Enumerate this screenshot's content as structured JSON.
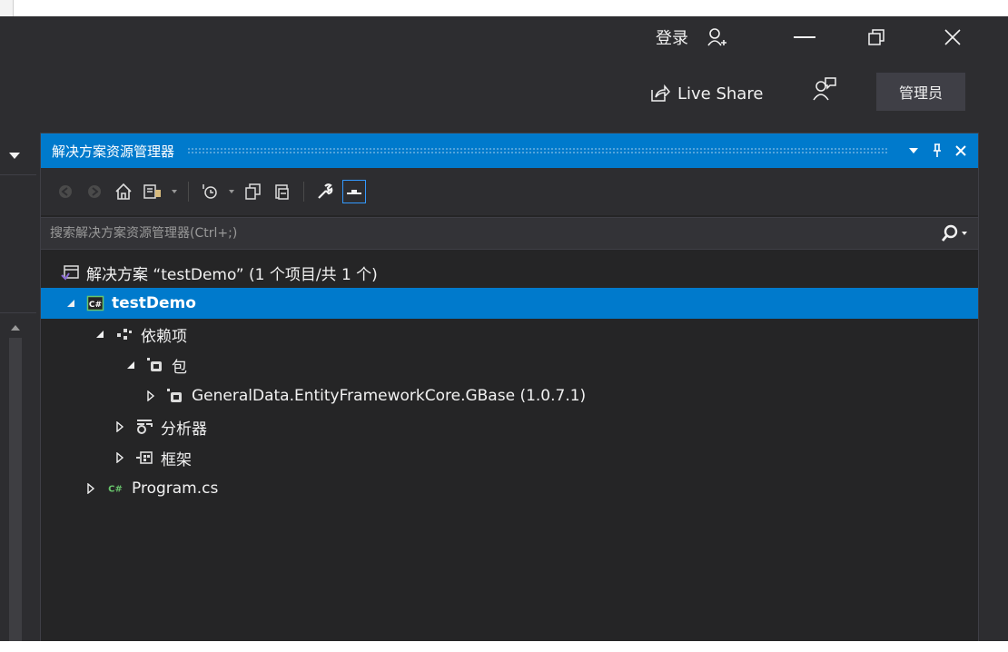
{
  "window": {
    "login_label": "登录",
    "admin_label": "管理员",
    "live_share_label": "Live Share"
  },
  "solution_explorer": {
    "title": "解决方案资源管理器",
    "search_placeholder": "搜索解决方案资源管理器(Ctrl+;)",
    "tree": {
      "solution": "解决方案 “testDemo” (1 个项目/共 1 个)",
      "project": "testDemo",
      "dependencies": "依赖项",
      "packages": "包",
      "package_item": "GeneralData.EntityFrameworkCore.GBase (1.0.7.1)",
      "analyzers": "分析器",
      "frameworks": "框架",
      "program_file": "Program.cs"
    }
  },
  "colors": {
    "accent": "#007acc",
    "background": "#2d2d30",
    "panel": "#252526",
    "csharp_green": "#68c56c"
  }
}
